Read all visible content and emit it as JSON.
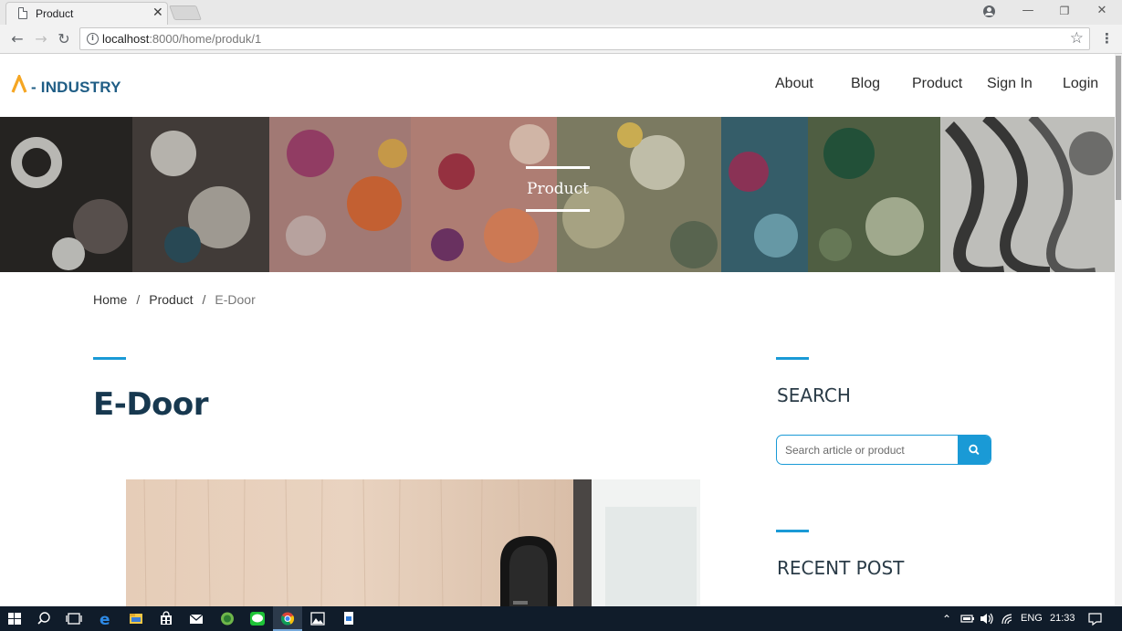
{
  "browser": {
    "tab_title": "Product",
    "url_host": "localhost",
    "url_path": ":8000/home/produk/1"
  },
  "site": {
    "logo_text": "- INDUSTRY",
    "nav": [
      "About",
      "Blog",
      "Product",
      "Sign In",
      "Login"
    ]
  },
  "banner": {
    "title": "Product"
  },
  "breadcrumb": {
    "home": "Home",
    "section": "Product",
    "current": "E-Door",
    "separator": "/"
  },
  "product": {
    "title": "E-Door"
  },
  "sidebar": {
    "search_heading": "SEARCH",
    "search_placeholder": "Search article or product",
    "recent_heading": "RECENT POST"
  },
  "taskbar": {
    "language": "ENG",
    "time": "21:33"
  },
  "colors": {
    "accent": "#1a9ad6",
    "brand": "#1f5d85",
    "logo_mark": "#f5a623",
    "title": "#17384f"
  }
}
